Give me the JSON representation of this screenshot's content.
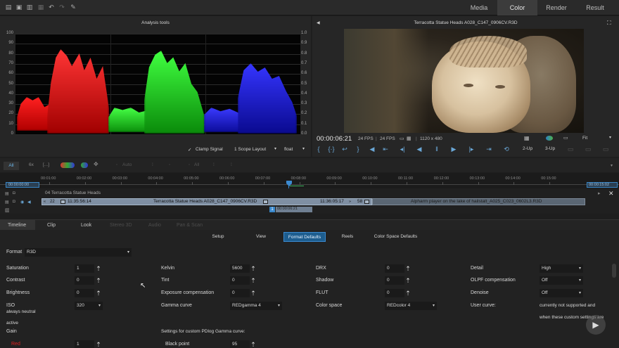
{
  "topbar": {
    "tabs": [
      "Media",
      "Color",
      "Render",
      "Result"
    ],
    "active_tab": "Color"
  },
  "analysis": {
    "title": "Analysis tools",
    "y_left": [
      "100",
      "90",
      "80",
      "70",
      "60",
      "50",
      "40",
      "30",
      "20",
      "10",
      "0"
    ],
    "y_right": [
      "1.0",
      "0.9",
      "0.8",
      "0.7",
      "0.6",
      "0.5",
      "0.4",
      "0.3",
      "0.2",
      "0.1",
      "0.0"
    ],
    "clamp_label": "Clamp Signal",
    "scope_layout": "1 Scope Layout",
    "float_label": "float"
  },
  "viewer": {
    "title": "Terracotta Statue Heads A028_C147_0906CV.R3D",
    "timecode": "00:00:06:21",
    "fps1": "24 FPS",
    "fps2": "24 FPS",
    "resolution": "1120 x 480",
    "fit": "Fit",
    "view_2up": "2-Up",
    "view_3up": "3-Up"
  },
  "timeline_toolbar": {
    "all": "All",
    "speed": "6x",
    "auto": "Auto",
    "all2": "All"
  },
  "ruler": {
    "start": "00:00:00:00",
    "ticks": [
      "00:01:00",
      "00:02:00",
      "00:03:00",
      "00:04:00",
      "00:05:00",
      "00:06:00",
      "00:07:00",
      "00:08:00",
      "00:09:00",
      "00:10:00",
      "00:11:00",
      "00:12:00",
      "00:13:00",
      "00:14:00",
      "00:15:00"
    ],
    "end": "00:00:15:02"
  },
  "track": {
    "name": "04 Terracotta Statue Heads",
    "clip_count": "22",
    "clip_tc_in": "11:35:56:14",
    "clip_name": "Terracotta Statue Heads A028_C147_0906CV.R3D",
    "clip_tc_out": "11:36:05:17",
    "clip_frames": "58",
    "next_clip": "Alpharm player on the lake of hailstalt_A025_C023_0602L3.R3D",
    "playhead_num": "1",
    "playhead_tc": "00:00:06:21"
  },
  "bottom_tabs": [
    "Timeline",
    "Clip",
    "Look",
    "Stereo 3D",
    "Audio",
    "Pan & Scan"
  ],
  "sub_tabs": [
    "Setup",
    "View",
    "Format Defaults",
    "Reels",
    "Color Space Defaults"
  ],
  "active_sub_tab": "Format Defaults",
  "format": {
    "label": "Format",
    "value": "R3D"
  },
  "col1": {
    "saturation": {
      "label": "Saturation",
      "value": "1"
    },
    "contrast": {
      "label": "Contrast",
      "value": "0"
    },
    "brightness": {
      "label": "Brightness",
      "value": "0"
    },
    "iso": {
      "label": "ISO",
      "value": "320"
    },
    "always_neutral": "always neutral",
    "active": "active",
    "gain": "Gain",
    "red": {
      "label": "Red",
      "value": "1"
    }
  },
  "col2": {
    "kelvin": {
      "label": "Kelvin",
      "value": "5600"
    },
    "tint": {
      "label": "Tint",
      "value": "0"
    },
    "exposure": {
      "label": "Exposure compensation",
      "value": "0"
    },
    "gamma": {
      "label": "Gamma curve",
      "value": "REDgamma 4"
    },
    "pdlog": "Settings for custom PDlog Gamma curve:",
    "black": {
      "label": "Black point",
      "value": "95"
    }
  },
  "col3": {
    "drx": {
      "label": "DRX",
      "value": "0"
    },
    "shadow": {
      "label": "Shadow",
      "value": "0"
    },
    "flut": {
      "label": "FLUT",
      "value": "0"
    },
    "colorspace": {
      "label": "Color space",
      "value": "REDcolor 4"
    }
  },
  "col4": {
    "detail": {
      "label": "Detail",
      "value": "High"
    },
    "olpf": {
      "label": "OLPF compensation",
      "value": "Off"
    },
    "denoise": {
      "label": "Denoise",
      "value": "Off"
    },
    "user_curve": {
      "label": "User curve:",
      "value": "currently not supported and"
    },
    "user_curve2": "when these custom settings are"
  },
  "colors": {
    "accent": "#1d5d8f",
    "timeline_clip": "#7f8fa3",
    "red": "#e01a1a",
    "green": "#1ecf1e",
    "blue": "#1e1edc"
  }
}
